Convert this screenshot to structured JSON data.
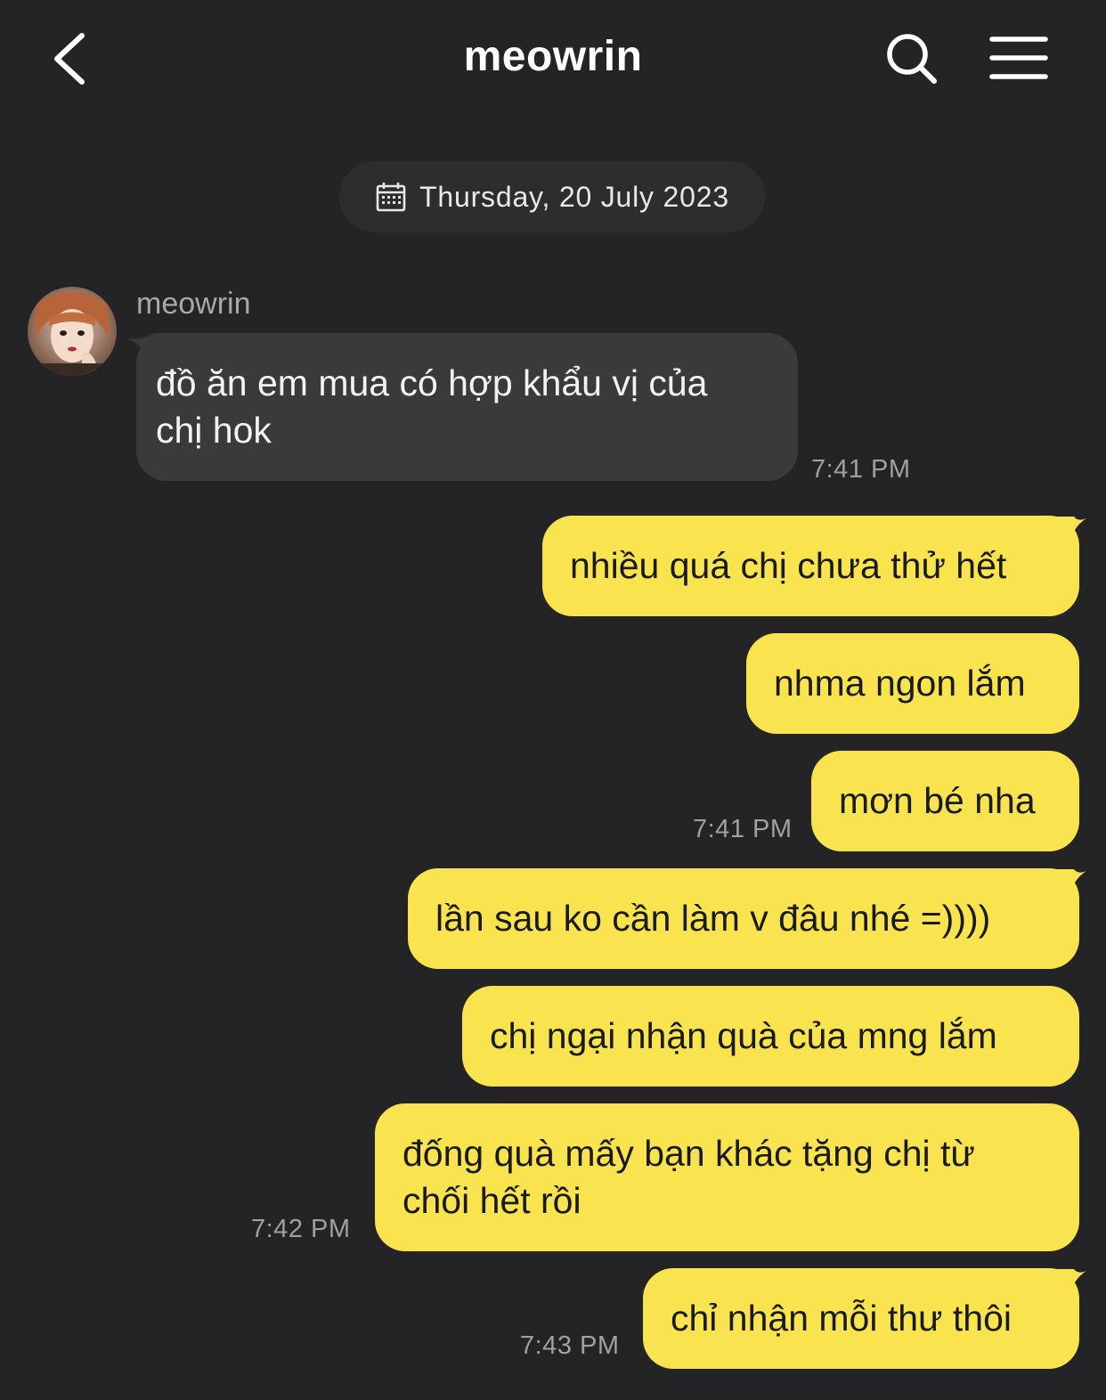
{
  "header": {
    "title": "meowrin",
    "back_icon": "chevron-left-icon",
    "search_icon": "search-icon",
    "menu_icon": "hamburger-menu-icon"
  },
  "date_divider": {
    "icon": "calendar-icon",
    "text": "Thursday, 20 July 2023"
  },
  "incoming": {
    "sender": "meowrin",
    "avatar_icon": "avatar",
    "messages": [
      {
        "line1": "đồ ăn em mua có hợp khẩu vị của",
        "line2": "chị hok",
        "time": "7:41 PM"
      }
    ]
  },
  "outgoing": {
    "messages": [
      {
        "text": "nhiều quá chị chưa thử hết"
      },
      {
        "text": "nhma ngon lắm"
      },
      {
        "text": "mơn bé nha",
        "time": "7:41 PM"
      },
      {
        "text": "lần sau ko cần làm v đâu nhé =))))"
      },
      {
        "text": "chị ngại nhận quà của mng lắm"
      },
      {
        "line1": "đống quà mấy bạn khác tặng chị từ",
        "line2": "chối hết rồi",
        "time": "7:42 PM"
      },
      {
        "text": "chỉ nhận mỗi thư thôi",
        "time": "7:43 PM"
      }
    ]
  },
  "colors": {
    "background": "#242426",
    "incoming_bubble": "#3a3a3c",
    "outgoing_bubble": "#f9e450"
  }
}
